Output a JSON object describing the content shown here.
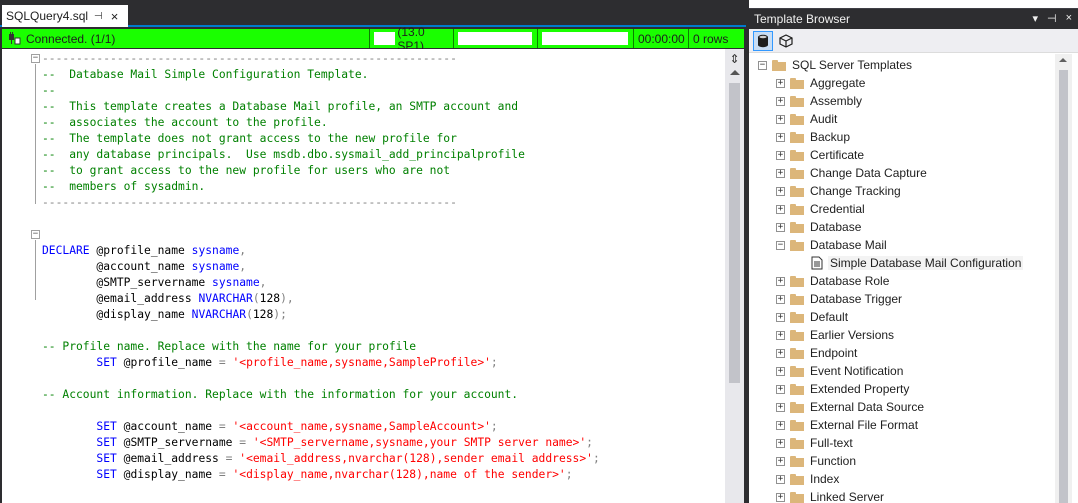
{
  "editor": {
    "tab_title": "SQLQuery4.sql",
    "tab_pin": "⊣",
    "tab_close": "×",
    "status": {
      "connected": "Connected. (1/1)",
      "version": "(13.0 SP1)",
      "elapsed": "00:00:00",
      "rows": "0 rows"
    },
    "lines": [
      [
        [
          "gy",
          "-------------------------------------------------------------"
        ]
      ],
      [
        [
          "cm",
          "--  Database Mail Simple Configuration Template."
        ]
      ],
      [
        [
          "cm",
          "--"
        ]
      ],
      [
        [
          "cm",
          "--  This template creates a Database Mail profile, an SMTP account and"
        ]
      ],
      [
        [
          "cm",
          "--  associates the account to the profile."
        ]
      ],
      [
        [
          "cm",
          "--  The template does not grant access to the new profile for"
        ]
      ],
      [
        [
          "cm",
          "--  any database principals.  Use msdb.dbo.sysmail_add_principalprofile"
        ]
      ],
      [
        [
          "cm",
          "--  to grant access to the new profile for users who are not"
        ]
      ],
      [
        [
          "cm",
          "--  members of sysadmin."
        ]
      ],
      [
        [
          "gy",
          "-------------------------------------------------------------"
        ]
      ],
      [],
      [],
      [
        [
          "kw",
          "DECLARE "
        ],
        [
          "tx",
          "@profile_name "
        ],
        [
          "kw",
          "sysname"
        ],
        [
          "gy",
          ","
        ]
      ],
      [
        [
          "tx",
          "        @account_name "
        ],
        [
          "kw",
          "sysname"
        ],
        [
          "gy",
          ","
        ]
      ],
      [
        [
          "tx",
          "        @SMTP_servername "
        ],
        [
          "kw",
          "sysname"
        ],
        [
          "gy",
          ","
        ]
      ],
      [
        [
          "tx",
          "        @email_address "
        ],
        [
          "kw",
          "NVARCHAR"
        ],
        [
          "gy",
          "("
        ],
        [
          "tx",
          "128"
        ],
        [
          "gy",
          "),"
        ]
      ],
      [
        [
          "tx",
          "        @display_name "
        ],
        [
          "kw",
          "NVARCHAR"
        ],
        [
          "gy",
          "("
        ],
        [
          "tx",
          "128"
        ],
        [
          "gy",
          ");"
        ]
      ],
      [],
      [
        [
          "cm",
          "-- Profile name. Replace with the name for your profile"
        ]
      ],
      [
        [
          "tx",
          "        "
        ],
        [
          "kw",
          "SET "
        ],
        [
          "tx",
          "@profile_name "
        ],
        [
          "gy",
          "= "
        ],
        [
          "st",
          "'<profile_name,sysname,SampleProfile>'"
        ],
        [
          "gy",
          ";"
        ]
      ],
      [],
      [
        [
          "cm",
          "-- Account information. Replace with the information for your account."
        ]
      ],
      [],
      [
        [
          "tx",
          "        "
        ],
        [
          "kw",
          "SET "
        ],
        [
          "tx",
          "@account_name "
        ],
        [
          "gy",
          "= "
        ],
        [
          "st",
          "'<account_name,sysname,SampleAccount>'"
        ],
        [
          "gy",
          ";"
        ]
      ],
      [
        [
          "tx",
          "        "
        ],
        [
          "kw",
          "SET "
        ],
        [
          "tx",
          "@SMTP_servername "
        ],
        [
          "gy",
          "= "
        ],
        [
          "st",
          "'<SMTP_servername,sysname,your SMTP server name>'"
        ],
        [
          "gy",
          ";"
        ]
      ],
      [
        [
          "tx",
          "        "
        ],
        [
          "kw",
          "SET "
        ],
        [
          "tx",
          "@email_address "
        ],
        [
          "gy",
          "= "
        ],
        [
          "st",
          "'<email_address,nvarchar(128),sender email address>'"
        ],
        [
          "gy",
          ";"
        ]
      ],
      [
        [
          "tx",
          "        "
        ],
        [
          "kw",
          "SET "
        ],
        [
          "tx",
          "@display_name "
        ],
        [
          "gy",
          "= "
        ],
        [
          "st",
          "'<display_name,nvarchar(128),name of the sender>'"
        ],
        [
          "gy",
          ";"
        ]
      ]
    ]
  },
  "template_browser": {
    "title": "Template Browser",
    "controls": [
      "▾",
      "⊣",
      "×"
    ],
    "tree": {
      "root": "SQL Server Templates",
      "items": [
        {
          "label": "Aggregate",
          "expanded": false
        },
        {
          "label": "Assembly",
          "expanded": false
        },
        {
          "label": "Audit",
          "expanded": false
        },
        {
          "label": "Backup",
          "expanded": false
        },
        {
          "label": "Certificate",
          "expanded": false
        },
        {
          "label": "Change Data Capture",
          "expanded": false
        },
        {
          "label": "Change Tracking",
          "expanded": false
        },
        {
          "label": "Credential",
          "expanded": false
        },
        {
          "label": "Database",
          "expanded": false
        },
        {
          "label": "Database Mail",
          "expanded": true,
          "children": [
            "Simple Database Mail Configuration"
          ]
        },
        {
          "label": "Database Role",
          "expanded": false
        },
        {
          "label": "Database Trigger",
          "expanded": false
        },
        {
          "label": "Default",
          "expanded": false
        },
        {
          "label": "Earlier Versions",
          "expanded": false
        },
        {
          "label": "Endpoint",
          "expanded": false
        },
        {
          "label": "Event Notification",
          "expanded": false
        },
        {
          "label": "Extended Property",
          "expanded": false
        },
        {
          "label": "External Data Source",
          "expanded": false
        },
        {
          "label": "External File Format",
          "expanded": false
        },
        {
          "label": "Full-text",
          "expanded": false
        },
        {
          "label": "Function",
          "expanded": false
        },
        {
          "label": "Index",
          "expanded": false
        },
        {
          "label": "Linked Server",
          "expanded": false
        }
      ]
    }
  },
  "colors": {
    "status_green": "#1aff00",
    "accent": "#007acc",
    "comment": "#008000",
    "keyword": "#0000ff",
    "string": "#ff0000"
  }
}
